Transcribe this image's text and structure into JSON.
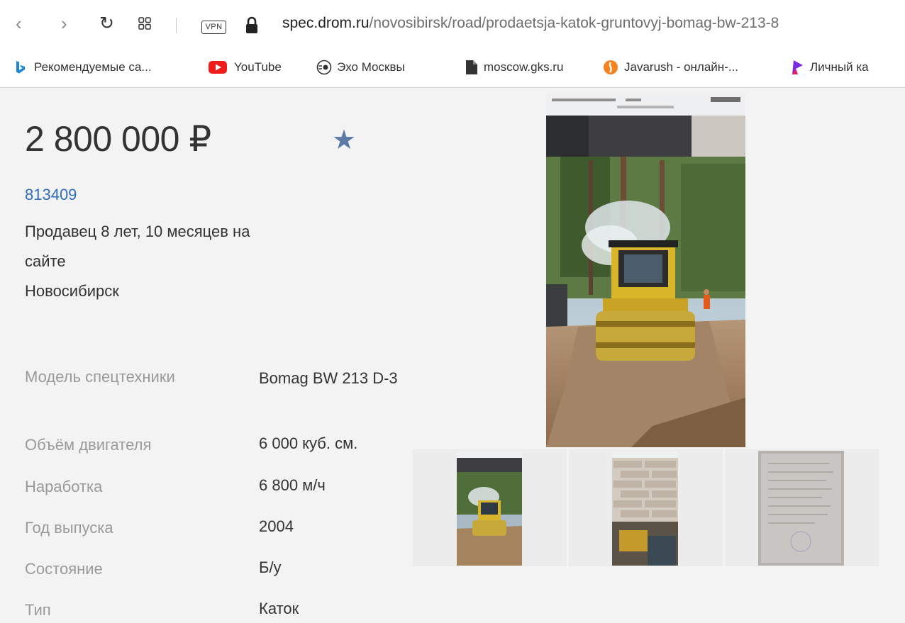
{
  "browser": {
    "url_domain": "spec.drom.ru",
    "url_path": "/novosibirsk/road/prodaetsja-katok-gruntovyj-bomag-bw-213-8",
    "vpn_label": "VPN",
    "icons": [
      "back-icon",
      "forward-icon",
      "reload-icon",
      "tabs-grid-icon",
      "lock-icon"
    ]
  },
  "bookmarks": [
    {
      "label": "Рекомендуемые са...",
      "icon": "bing-icon"
    },
    {
      "label": "YouTube",
      "icon": "youtube-icon"
    },
    {
      "label": "Эхо Москвы",
      "icon": "echo-icon"
    },
    {
      "label": "moscow.gks.ru",
      "icon": "page-icon"
    },
    {
      "label": "Javarush - онлайн-...",
      "icon": "javarush-icon"
    },
    {
      "label": "Личный ка",
      "icon": "pennant-icon"
    }
  ],
  "listing": {
    "price": "2 800 000 ₽",
    "seller_id": "813409",
    "seller_line1": "Продавец 8 лет, 10 месяцев на",
    "seller_line2": "сайте",
    "city": "Новосибирск",
    "specs": [
      {
        "label": "Модель спецтехники",
        "value": "Bomag BW 213 D-3"
      },
      {
        "label": "Объём двигателя",
        "value": "6 000 куб. см."
      },
      {
        "label": "Наработка",
        "value": "6 800 м/ч"
      },
      {
        "label": "Год выпуска",
        "value": "2004"
      },
      {
        "label": "Состояние",
        "value": "Б/у"
      },
      {
        "label": "Тип",
        "value": "Каток"
      }
    ]
  },
  "colors": {
    "accent_link": "#2f6fba",
    "star": "#5b7ba5",
    "page_bg": "#f3f3f3"
  }
}
